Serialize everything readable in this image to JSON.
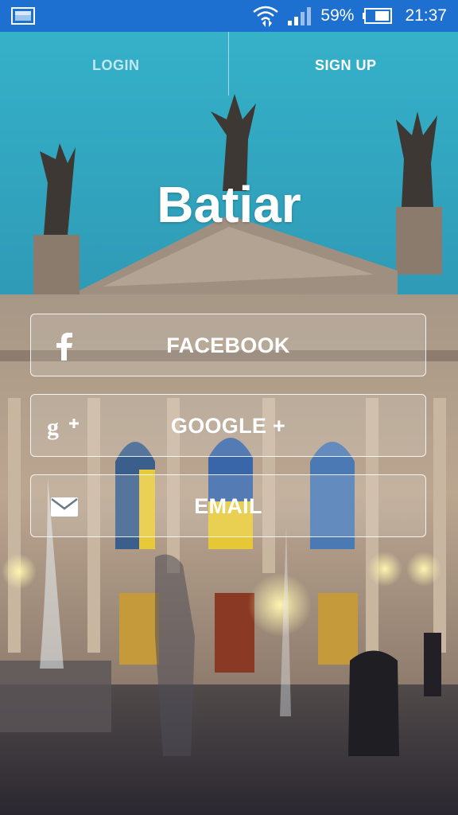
{
  "status_bar": {
    "battery_percent": "59%",
    "time": "21:37",
    "icons": [
      "screenshot-icon",
      "wifi-icon",
      "signal-icon",
      "battery-icon"
    ],
    "color": "#1d6fd0"
  },
  "tabs": {
    "login_label": "LOGIN",
    "signup_label": "SIGN UP",
    "active": "SIGN UP"
  },
  "title": "Batiar",
  "buttons": {
    "facebook": {
      "label": "FACEBOOK",
      "icon": "facebook-icon"
    },
    "google": {
      "label": "GOOGLE +",
      "icon": "google-plus-icon"
    },
    "email": {
      "label": "EMAIL",
      "icon": "mail-icon"
    }
  },
  "colors": {
    "sky_top": "#3bb7cc",
    "sky_bottom": "#2c8fae",
    "building": "#b9a691",
    "button_border": "#ffffff"
  }
}
